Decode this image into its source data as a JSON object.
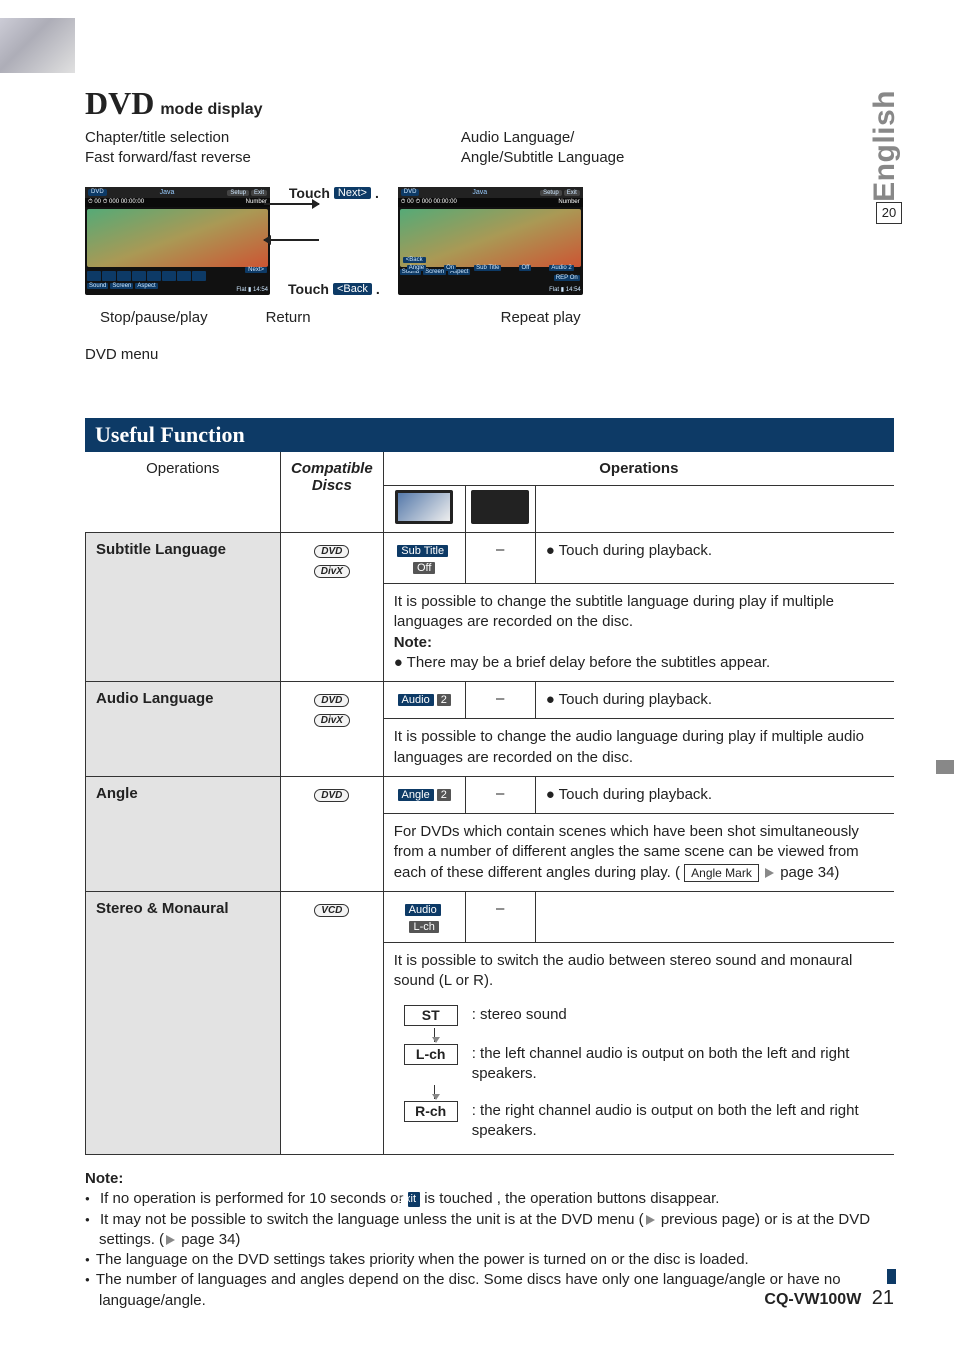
{
  "side": {
    "lang": "English",
    "page_box": "20"
  },
  "title": {
    "big": "DVD",
    "small": "mode display"
  },
  "under": {
    "left1": "Chapter/title selection",
    "left2": "Fast forward/fast reverse",
    "right1": "Audio Language/",
    "right2": "Angle/Subtitle Language"
  },
  "arrows": {
    "touch": "Touch",
    "next": "Next>",
    "back": "<Back",
    "period": "."
  },
  "callouts": {
    "stop": "Stop/pause/play",
    "return": "Return",
    "repeat": "Repeat play",
    "dvdmenu": "DVD menu"
  },
  "section_bar": "Useful Function",
  "header": {
    "operations_left": "Operations",
    "compatible_discs": "Compatible\nDiscs",
    "operations_right": "Operations"
  },
  "discs": {
    "dvd": "DVD",
    "divx": "DivX",
    "vcd": "VCD"
  },
  "rows": {
    "subtitle": {
      "name": "Subtitle Language",
      "chip1": "Sub Title",
      "chip2": "Off",
      "remote": "–",
      "bullet": "Touch during playback.",
      "body": "It is possible to change the subtitle language during play if multiple languages are recorded on the disc.",
      "note_label": "Note:",
      "note_body": "There may be a brief delay before the subtitles appear."
    },
    "audio": {
      "name": "Audio Language",
      "chip1": "Audio",
      "chip2": "2",
      "remote": "–",
      "bullet": "Touch during playback.",
      "body": "It is possible to change the audio language during play if multiple audio languages are recorded on the disc."
    },
    "angle": {
      "name": "Angle",
      "chip1": "Angle",
      "chip2": "2",
      "remote": "–",
      "bullet": "Touch during playback.",
      "body1": "For DVDs which contain scenes which have been shot simultaneously from a number of different angles the same scene can be viewed from each of these different angles during play. (",
      "ref_box": "Angle Mark",
      "body2": " page 34)"
    },
    "stereo": {
      "name": "Stereo & Monaural",
      "chip1": "Audio",
      "chip2": "L-ch",
      "remote": "–",
      "body": "It is possible to switch the audio between stereo sound and monaural sound (L or R).",
      "flow": {
        "st": "ST",
        "st_desc": ": stereo sound",
        "l": "L-ch",
        "l_desc": ": the left channel audio is output on both the left and right speakers.",
        "r": "R-ch",
        "r_desc": ": the right channel audio is output on both the left and right speakers."
      }
    }
  },
  "notes": {
    "heading": "Note:",
    "n1a": "If no operation is performed for 10 seconds or ",
    "n1_exit": "Exit",
    "n1b": " is touched , the operation buttons disappear.",
    "n2a": "It may not be possible to switch the language unless the unit is at the DVD menu (",
    "n2b": " previous page) or is at the DVD settings. (",
    "n2c": " page 34)",
    "n3": "The language on the DVD settings takes priority when the power is turned on or the disc is loaded.",
    "n4": "The number of languages and angles depend on the disc. Some discs have only one language/angle or have no language/angle."
  },
  "footer": {
    "model": "CQ-VW100W",
    "page": "21"
  }
}
